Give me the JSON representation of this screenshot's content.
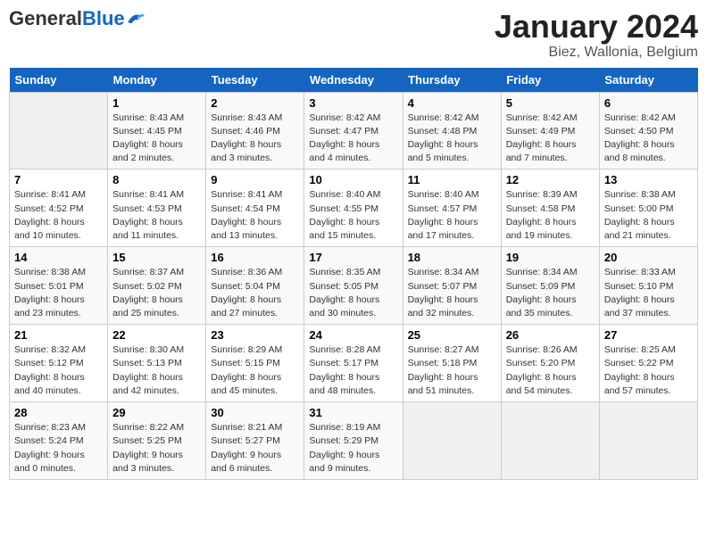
{
  "logo": {
    "general": "General",
    "blue": "Blue"
  },
  "title": "January 2024",
  "subtitle": "Biez, Wallonia, Belgium",
  "days_of_week": [
    "Sunday",
    "Monday",
    "Tuesday",
    "Wednesday",
    "Thursday",
    "Friday",
    "Saturday"
  ],
  "weeks": [
    [
      {
        "day": "",
        "info": ""
      },
      {
        "day": "1",
        "info": "Sunrise: 8:43 AM\nSunset: 4:45 PM\nDaylight: 8 hours\nand 2 minutes."
      },
      {
        "day": "2",
        "info": "Sunrise: 8:43 AM\nSunset: 4:46 PM\nDaylight: 8 hours\nand 3 minutes."
      },
      {
        "day": "3",
        "info": "Sunrise: 8:42 AM\nSunset: 4:47 PM\nDaylight: 8 hours\nand 4 minutes."
      },
      {
        "day": "4",
        "info": "Sunrise: 8:42 AM\nSunset: 4:48 PM\nDaylight: 8 hours\nand 5 minutes."
      },
      {
        "day": "5",
        "info": "Sunrise: 8:42 AM\nSunset: 4:49 PM\nDaylight: 8 hours\nand 7 minutes."
      },
      {
        "day": "6",
        "info": "Sunrise: 8:42 AM\nSunset: 4:50 PM\nDaylight: 8 hours\nand 8 minutes."
      }
    ],
    [
      {
        "day": "7",
        "info": "Sunrise: 8:41 AM\nSunset: 4:52 PM\nDaylight: 8 hours\nand 10 minutes."
      },
      {
        "day": "8",
        "info": "Sunrise: 8:41 AM\nSunset: 4:53 PM\nDaylight: 8 hours\nand 11 minutes."
      },
      {
        "day": "9",
        "info": "Sunrise: 8:41 AM\nSunset: 4:54 PM\nDaylight: 8 hours\nand 13 minutes."
      },
      {
        "day": "10",
        "info": "Sunrise: 8:40 AM\nSunset: 4:55 PM\nDaylight: 8 hours\nand 15 minutes."
      },
      {
        "day": "11",
        "info": "Sunrise: 8:40 AM\nSunset: 4:57 PM\nDaylight: 8 hours\nand 17 minutes."
      },
      {
        "day": "12",
        "info": "Sunrise: 8:39 AM\nSunset: 4:58 PM\nDaylight: 8 hours\nand 19 minutes."
      },
      {
        "day": "13",
        "info": "Sunrise: 8:38 AM\nSunset: 5:00 PM\nDaylight: 8 hours\nand 21 minutes."
      }
    ],
    [
      {
        "day": "14",
        "info": "Sunrise: 8:38 AM\nSunset: 5:01 PM\nDaylight: 8 hours\nand 23 minutes."
      },
      {
        "day": "15",
        "info": "Sunrise: 8:37 AM\nSunset: 5:02 PM\nDaylight: 8 hours\nand 25 minutes."
      },
      {
        "day": "16",
        "info": "Sunrise: 8:36 AM\nSunset: 5:04 PM\nDaylight: 8 hours\nand 27 minutes."
      },
      {
        "day": "17",
        "info": "Sunrise: 8:35 AM\nSunset: 5:05 PM\nDaylight: 8 hours\nand 30 minutes."
      },
      {
        "day": "18",
        "info": "Sunrise: 8:34 AM\nSunset: 5:07 PM\nDaylight: 8 hours\nand 32 minutes."
      },
      {
        "day": "19",
        "info": "Sunrise: 8:34 AM\nSunset: 5:09 PM\nDaylight: 8 hours\nand 35 minutes."
      },
      {
        "day": "20",
        "info": "Sunrise: 8:33 AM\nSunset: 5:10 PM\nDaylight: 8 hours\nand 37 minutes."
      }
    ],
    [
      {
        "day": "21",
        "info": "Sunrise: 8:32 AM\nSunset: 5:12 PM\nDaylight: 8 hours\nand 40 minutes."
      },
      {
        "day": "22",
        "info": "Sunrise: 8:30 AM\nSunset: 5:13 PM\nDaylight: 8 hours\nand 42 minutes."
      },
      {
        "day": "23",
        "info": "Sunrise: 8:29 AM\nSunset: 5:15 PM\nDaylight: 8 hours\nand 45 minutes."
      },
      {
        "day": "24",
        "info": "Sunrise: 8:28 AM\nSunset: 5:17 PM\nDaylight: 8 hours\nand 48 minutes."
      },
      {
        "day": "25",
        "info": "Sunrise: 8:27 AM\nSunset: 5:18 PM\nDaylight: 8 hours\nand 51 minutes."
      },
      {
        "day": "26",
        "info": "Sunrise: 8:26 AM\nSunset: 5:20 PM\nDaylight: 8 hours\nand 54 minutes."
      },
      {
        "day": "27",
        "info": "Sunrise: 8:25 AM\nSunset: 5:22 PM\nDaylight: 8 hours\nand 57 minutes."
      }
    ],
    [
      {
        "day": "28",
        "info": "Sunrise: 8:23 AM\nSunset: 5:24 PM\nDaylight: 9 hours\nand 0 minutes."
      },
      {
        "day": "29",
        "info": "Sunrise: 8:22 AM\nSunset: 5:25 PM\nDaylight: 9 hours\nand 3 minutes."
      },
      {
        "day": "30",
        "info": "Sunrise: 8:21 AM\nSunset: 5:27 PM\nDaylight: 9 hours\nand 6 minutes."
      },
      {
        "day": "31",
        "info": "Sunrise: 8:19 AM\nSunset: 5:29 PM\nDaylight: 9 hours\nand 9 minutes."
      },
      {
        "day": "",
        "info": ""
      },
      {
        "day": "",
        "info": ""
      },
      {
        "day": "",
        "info": ""
      }
    ]
  ]
}
